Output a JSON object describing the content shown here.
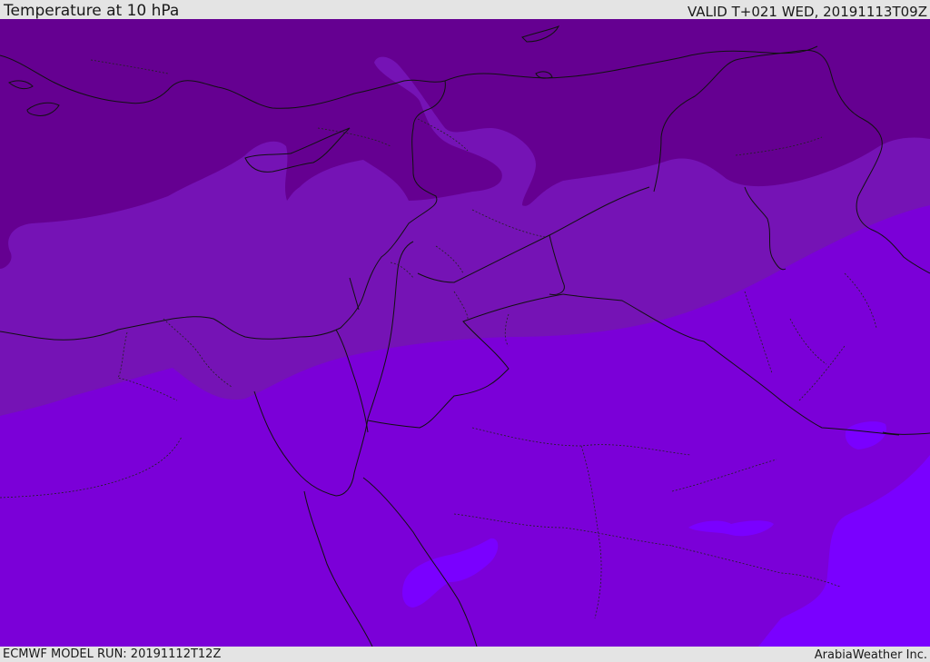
{
  "header": {
    "title": "Temperature at 10 hPa",
    "valid_time": "VALID T+021 WED, 20191113T09Z"
  },
  "footer": {
    "model_run": "ECMWF MODEL RUN: 20191112T12Z",
    "credit": "ArabiaWeather Inc."
  },
  "map": {
    "colors": {
      "coldest": "#650091",
      "cold": "#7513b5",
      "mid": "#7b00d8",
      "warm": "#7a00ff",
      "border": "#111111"
    }
  }
}
